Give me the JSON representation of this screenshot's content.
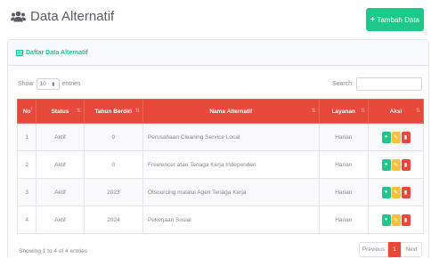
{
  "header": {
    "title": "Data Alternatif",
    "add_button": "Tambah Data",
    "add_plus": "+"
  },
  "card": {
    "title": "Daftar Data Alternatif"
  },
  "controls": {
    "show_label": "Show",
    "length_value": "10",
    "entries_label": "entries",
    "search_label": "Search:",
    "search_value": ""
  },
  "table": {
    "columns": [
      "No",
      "Status",
      "Tahun Berdiri",
      "Nama Alternatif",
      "Layanan",
      "Aksi"
    ],
    "rows": [
      {
        "no": "1",
        "status": "Aktif",
        "tahun": "0",
        "nama": "Perusahaan Cleaning Service Local",
        "layanan": "Harian"
      },
      {
        "no": "2",
        "status": "Aktif",
        "tahun": "0",
        "nama": "Freelencer atau Tenaga Kerja Independen",
        "layanan": "Harian"
      },
      {
        "no": "3",
        "status": "Aktif",
        "tahun": "2023",
        "nama": "Otsourcing malalui Agen Tenaga Kerja",
        "layanan": "Harian"
      },
      {
        "no": "4",
        "status": "Aktif",
        "tahun": "2024",
        "nama": "Pekerjaan Sosial",
        "layanan": "Harian"
      }
    ]
  },
  "footer": {
    "info": "Showing 1 to 4 of 4 entries",
    "previous": "Previous",
    "current_page": "1",
    "next": "Next"
  },
  "colors": {
    "accent_red": "#e74a3b",
    "accent_green": "#1cc88a",
    "accent_yellow": "#f6c23e"
  },
  "icons": [
    "users-icon",
    "table-icon",
    "eye-icon",
    "edit-icon",
    "trash-icon",
    "sort-icon"
  ]
}
